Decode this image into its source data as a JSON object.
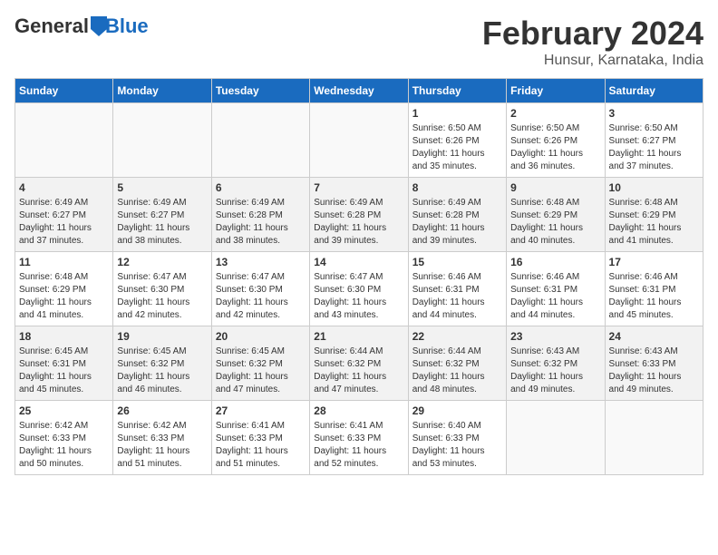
{
  "logo": {
    "general": "General",
    "blue": "Blue"
  },
  "title": "February 2024",
  "subtitle": "Hunsur, Karnataka, India",
  "weekdays": [
    "Sunday",
    "Monday",
    "Tuesday",
    "Wednesday",
    "Thursday",
    "Friday",
    "Saturday"
  ],
  "weeks": [
    [
      {
        "day": "",
        "info": ""
      },
      {
        "day": "",
        "info": ""
      },
      {
        "day": "",
        "info": ""
      },
      {
        "day": "",
        "info": ""
      },
      {
        "day": "1",
        "info": "Sunrise: 6:50 AM\nSunset: 6:26 PM\nDaylight: 11 hours\nand 35 minutes."
      },
      {
        "day": "2",
        "info": "Sunrise: 6:50 AM\nSunset: 6:26 PM\nDaylight: 11 hours\nand 36 minutes."
      },
      {
        "day": "3",
        "info": "Sunrise: 6:50 AM\nSunset: 6:27 PM\nDaylight: 11 hours\nand 37 minutes."
      }
    ],
    [
      {
        "day": "4",
        "info": "Sunrise: 6:49 AM\nSunset: 6:27 PM\nDaylight: 11 hours\nand 37 minutes."
      },
      {
        "day": "5",
        "info": "Sunrise: 6:49 AM\nSunset: 6:27 PM\nDaylight: 11 hours\nand 38 minutes."
      },
      {
        "day": "6",
        "info": "Sunrise: 6:49 AM\nSunset: 6:28 PM\nDaylight: 11 hours\nand 38 minutes."
      },
      {
        "day": "7",
        "info": "Sunrise: 6:49 AM\nSunset: 6:28 PM\nDaylight: 11 hours\nand 39 minutes."
      },
      {
        "day": "8",
        "info": "Sunrise: 6:49 AM\nSunset: 6:28 PM\nDaylight: 11 hours\nand 39 minutes."
      },
      {
        "day": "9",
        "info": "Sunrise: 6:48 AM\nSunset: 6:29 PM\nDaylight: 11 hours\nand 40 minutes."
      },
      {
        "day": "10",
        "info": "Sunrise: 6:48 AM\nSunset: 6:29 PM\nDaylight: 11 hours\nand 41 minutes."
      }
    ],
    [
      {
        "day": "11",
        "info": "Sunrise: 6:48 AM\nSunset: 6:29 PM\nDaylight: 11 hours\nand 41 minutes."
      },
      {
        "day": "12",
        "info": "Sunrise: 6:47 AM\nSunset: 6:30 PM\nDaylight: 11 hours\nand 42 minutes."
      },
      {
        "day": "13",
        "info": "Sunrise: 6:47 AM\nSunset: 6:30 PM\nDaylight: 11 hours\nand 42 minutes."
      },
      {
        "day": "14",
        "info": "Sunrise: 6:47 AM\nSunset: 6:30 PM\nDaylight: 11 hours\nand 43 minutes."
      },
      {
        "day": "15",
        "info": "Sunrise: 6:46 AM\nSunset: 6:31 PM\nDaylight: 11 hours\nand 44 minutes."
      },
      {
        "day": "16",
        "info": "Sunrise: 6:46 AM\nSunset: 6:31 PM\nDaylight: 11 hours\nand 44 minutes."
      },
      {
        "day": "17",
        "info": "Sunrise: 6:46 AM\nSunset: 6:31 PM\nDaylight: 11 hours\nand 45 minutes."
      }
    ],
    [
      {
        "day": "18",
        "info": "Sunrise: 6:45 AM\nSunset: 6:31 PM\nDaylight: 11 hours\nand 45 minutes."
      },
      {
        "day": "19",
        "info": "Sunrise: 6:45 AM\nSunset: 6:32 PM\nDaylight: 11 hours\nand 46 minutes."
      },
      {
        "day": "20",
        "info": "Sunrise: 6:45 AM\nSunset: 6:32 PM\nDaylight: 11 hours\nand 47 minutes."
      },
      {
        "day": "21",
        "info": "Sunrise: 6:44 AM\nSunset: 6:32 PM\nDaylight: 11 hours\nand 47 minutes."
      },
      {
        "day": "22",
        "info": "Sunrise: 6:44 AM\nSunset: 6:32 PM\nDaylight: 11 hours\nand 48 minutes."
      },
      {
        "day": "23",
        "info": "Sunrise: 6:43 AM\nSunset: 6:32 PM\nDaylight: 11 hours\nand 49 minutes."
      },
      {
        "day": "24",
        "info": "Sunrise: 6:43 AM\nSunset: 6:33 PM\nDaylight: 11 hours\nand 49 minutes."
      }
    ],
    [
      {
        "day": "25",
        "info": "Sunrise: 6:42 AM\nSunset: 6:33 PM\nDaylight: 11 hours\nand 50 minutes."
      },
      {
        "day": "26",
        "info": "Sunrise: 6:42 AM\nSunset: 6:33 PM\nDaylight: 11 hours\nand 51 minutes."
      },
      {
        "day": "27",
        "info": "Sunrise: 6:41 AM\nSunset: 6:33 PM\nDaylight: 11 hours\nand 51 minutes."
      },
      {
        "day": "28",
        "info": "Sunrise: 6:41 AM\nSunset: 6:33 PM\nDaylight: 11 hours\nand 52 minutes."
      },
      {
        "day": "29",
        "info": "Sunrise: 6:40 AM\nSunset: 6:33 PM\nDaylight: 11 hours\nand 53 minutes."
      },
      {
        "day": "",
        "info": ""
      },
      {
        "day": "",
        "info": ""
      }
    ]
  ]
}
